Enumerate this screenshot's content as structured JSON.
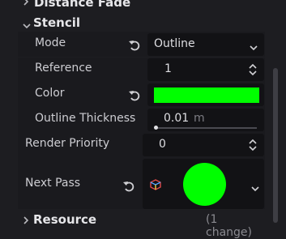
{
  "sections": {
    "distance_fade": {
      "label": "Distance Fade"
    },
    "stencil": {
      "label": "Stencil"
    },
    "resource": {
      "label": "Resource",
      "badge": "(1 change)"
    }
  },
  "properties": {
    "mode": {
      "label": "Mode",
      "value": "Outline"
    },
    "reference": {
      "label": "Reference",
      "value": "1"
    },
    "color": {
      "label": "Color",
      "value_hex": "#00ff00"
    },
    "outline_thickness": {
      "label": "Outline Thickness",
      "value": "0.01",
      "unit": "m",
      "slider_fraction": 0.0
    },
    "render_priority": {
      "label": "Render Priority",
      "value": "0"
    },
    "next_pass": {
      "label": "Next Pass",
      "preview_color": "#00ff00"
    }
  },
  "icons": {
    "revert": "revert-icon",
    "collapse": "chevron-down-icon",
    "expand": "chevron-right-icon",
    "spinner": "spinner-arrows-icon",
    "resource": "material-resource-icon"
  },
  "colors": {
    "background": "#1d1d21",
    "field": "#121215",
    "accent_green": "#00ff00"
  }
}
